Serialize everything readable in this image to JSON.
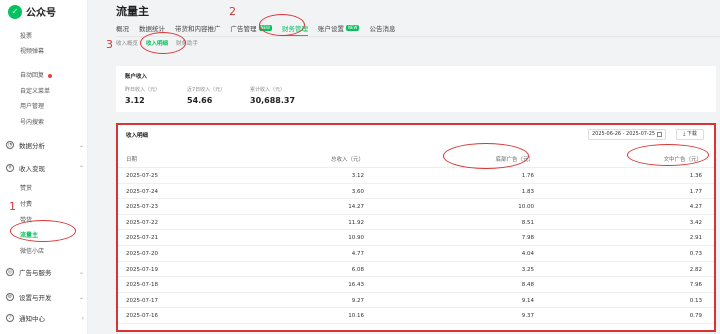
{
  "app": {
    "name": "公众号"
  },
  "sidebar": {
    "top_items": [
      {
        "label": "投票"
      },
      {
        "label": "视频弹幕"
      },
      {
        "label": "自动回复"
      },
      {
        "label": "自定义菜单"
      },
      {
        "label": "用户管理"
      },
      {
        "label": "号内搜索"
      }
    ],
    "groups": [
      {
        "label": "数据分析"
      },
      {
        "label": "收入变现"
      },
      {
        "label": "广告与服务"
      },
      {
        "label": "设置与开发"
      },
      {
        "label": "通知中心"
      }
    ],
    "revenue_items": [
      {
        "label": "赞赏"
      },
      {
        "label": "付费"
      },
      {
        "label": "带货"
      },
      {
        "label": "流量主"
      },
      {
        "label": "微信小店"
      }
    ]
  },
  "header": {
    "title": "流量主",
    "tabs": [
      {
        "label": "概况",
        "badge": ""
      },
      {
        "label": "数据统计",
        "badge": ""
      },
      {
        "label": "带货和内容推广",
        "badge": ""
      },
      {
        "label": "广告管理",
        "badge": "NEW"
      },
      {
        "label": "财务管理",
        "badge": ""
      },
      {
        "label": "账户设置",
        "badge": "NEW"
      },
      {
        "label": "公告消息",
        "badge": ""
      }
    ],
    "subtabs": [
      {
        "label": "收入概览"
      },
      {
        "label": "收入明细"
      },
      {
        "label": "财务助手"
      }
    ]
  },
  "account_income": {
    "title": "账户收入",
    "stats": [
      {
        "label": "昨日收入（元）",
        "value": "3.12"
      },
      {
        "label": "近7日收入（元）",
        "value": "54.66"
      },
      {
        "label": "累计收入（元）",
        "value": "30,688.37"
      }
    ]
  },
  "income_detail": {
    "title": "收入明细",
    "date_range": "2025-06-26 - 2025-07-25",
    "download_label": "下载",
    "columns": {
      "date": "日期",
      "total": "总收入（元）",
      "bottom_ad": "底部广告（元）",
      "mid_ad": "文中广告（元）"
    },
    "rows": [
      {
        "date": "2025-07-25",
        "total": "3.12",
        "bottom": "1.76",
        "mid": "1.36"
      },
      {
        "date": "2025-07-24",
        "total": "3.60",
        "bottom": "1.83",
        "mid": "1.77"
      },
      {
        "date": "2025-07-23",
        "total": "14.27",
        "bottom": "10.00",
        "mid": "4.27"
      },
      {
        "date": "2025-07-22",
        "total": "11.92",
        "bottom": "8.51",
        "mid": "3.42"
      },
      {
        "date": "2025-07-21",
        "total": "10.90",
        "bottom": "7.98",
        "mid": "2.91"
      },
      {
        "date": "2025-07-20",
        "total": "4.77",
        "bottom": "4.04",
        "mid": "0.73"
      },
      {
        "date": "2025-07-19",
        "total": "6.08",
        "bottom": "3.25",
        "mid": "2.82"
      },
      {
        "date": "2025-07-18",
        "total": "16.43",
        "bottom": "8.48",
        "mid": "7.96"
      },
      {
        "date": "2025-07-17",
        "total": "9.27",
        "bottom": "9.14",
        "mid": "0.13"
      },
      {
        "date": "2025-07-16",
        "total": "10.16",
        "bottom": "9.37",
        "mid": "0.79"
      }
    ]
  },
  "annotations": {
    "step1": "1",
    "step2": "2",
    "step3": "3",
    "color": "#d93434"
  },
  "colors": {
    "accent": "#07c160",
    "annotation": "#d93434"
  }
}
